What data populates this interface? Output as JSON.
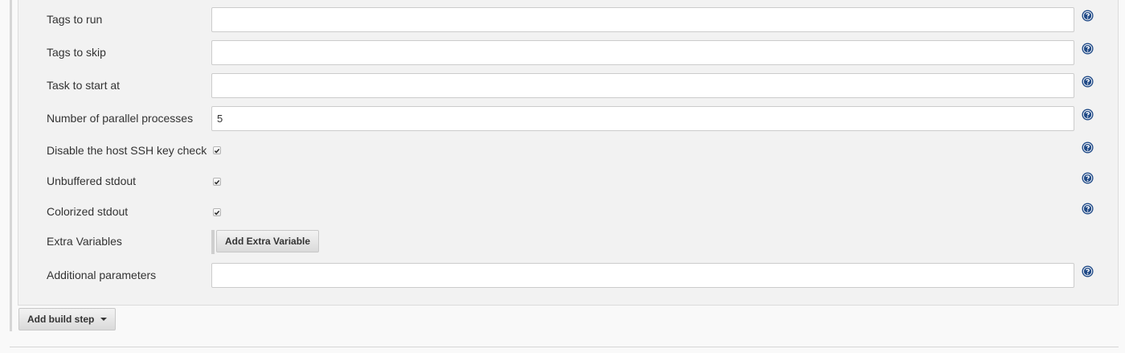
{
  "fields": [
    {
      "label": "Tags to run",
      "type": "text",
      "value": ""
    },
    {
      "label": "Tags to skip",
      "type": "text",
      "value": ""
    },
    {
      "label": "Task to start at",
      "type": "text",
      "value": ""
    },
    {
      "label": "Number of parallel processes",
      "type": "text",
      "value": "5"
    },
    {
      "label": "Disable the host SSH key check",
      "type": "checkbox",
      "checked": true
    },
    {
      "label": "Unbuffered stdout",
      "type": "checkbox",
      "checked": true
    },
    {
      "label": "Colorized stdout",
      "type": "checkbox",
      "checked": true
    },
    {
      "label": "Extra Variables",
      "type": "button",
      "button_label": "Add Extra Variable"
    },
    {
      "label": "Additional parameters",
      "type": "text",
      "value": ""
    }
  ],
  "add_build_step_label": "Add build step",
  "help_icon": "question-circle-icon",
  "colors": {
    "help_icon": "#204a87",
    "panel_bg": "#f2f2f2",
    "page_bg": "#f9f9f9"
  }
}
